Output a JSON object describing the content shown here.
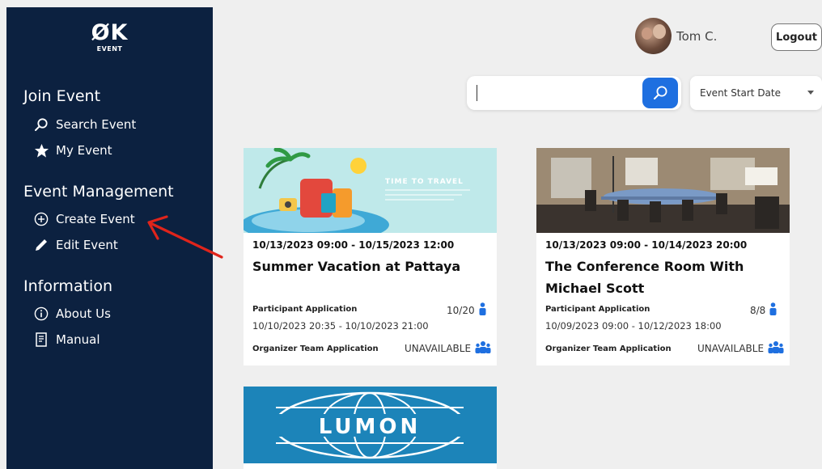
{
  "brand": {
    "mark": "ØK",
    "sub": "EVENT"
  },
  "sidebar": {
    "sections": [
      {
        "title": "Join Event",
        "items": [
          {
            "label": "Search Event",
            "icon": "search-icon"
          },
          {
            "label": "My Event",
            "icon": "star-icon"
          }
        ]
      },
      {
        "title": "Event Management",
        "items": [
          {
            "label": "Create Event",
            "icon": "plus-circle-icon"
          },
          {
            "label": "Edit Event",
            "icon": "pencil-icon"
          }
        ]
      },
      {
        "title": "Information",
        "items": [
          {
            "label": "About Us",
            "icon": "info-icon"
          },
          {
            "label": "Manual",
            "icon": "document-icon"
          }
        ]
      }
    ]
  },
  "header": {
    "user_name": "Tom C.",
    "logout_label": "Logout"
  },
  "search": {
    "value": "",
    "placeholder": "",
    "sort_value": "Event Start Date"
  },
  "colors": {
    "sidebar": "#0c2140",
    "accent": "#1e6fe0",
    "arrow": "#e0241b"
  },
  "cards": [
    {
      "date": "10/13/2023 09:00 - 10/15/2023 12:00",
      "title": "Summer Vacation at Pattaya",
      "participant_label": "Participant Application",
      "participant_count": "10/20",
      "participant_range": "10/10/2023 20:35 - 10/10/2023 21:00",
      "organizer_label": "Organizer Team Application",
      "organizer_status": "UNAVAILABLE",
      "image_text": "TIME TO TRAVEL"
    },
    {
      "date": "10/13/2023 09:00 - 10/14/2023 20:00",
      "title": "The Conference Room With Michael Scott",
      "participant_label": "Participant Application",
      "participant_count": "8/8",
      "participant_range": "10/09/2023 09:00 - 10/12/2023 18:00",
      "organizer_label": "Organizer Team Application",
      "organizer_status": "UNAVAILABLE",
      "image_text": ""
    },
    {
      "date": "",
      "title": "",
      "image_text": "LUMON"
    }
  ]
}
